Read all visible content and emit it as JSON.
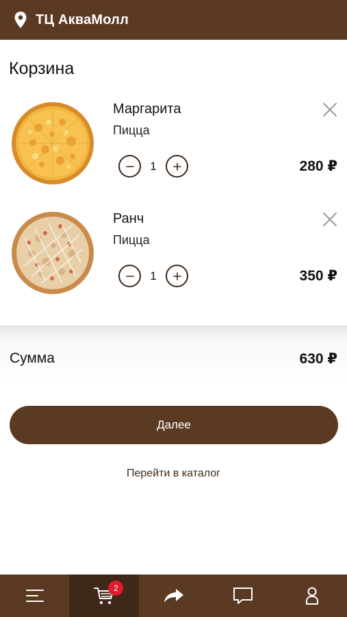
{
  "header": {
    "location": "ТЦ АкваМолл",
    "icon": "location-pin-icon"
  },
  "page": {
    "title": "Корзина"
  },
  "cart": {
    "items": [
      {
        "name": "Маргарита",
        "category": "Пицца",
        "quantity": "1",
        "price": "280 ₽"
      },
      {
        "name": "Ранч",
        "category": "Пицца",
        "quantity": "1",
        "price": "350 ₽"
      }
    ]
  },
  "summary": {
    "label": "Сумма",
    "total": "630 ₽"
  },
  "actions": {
    "next_label": "Далее",
    "catalog_link": "Перейти в каталог"
  },
  "tabbar": {
    "cart_badge": "2",
    "active_tab": "cart"
  },
  "colors": {
    "brand": "#5a3a22",
    "brand_dark": "#3f2818",
    "badge": "#e21b2e"
  }
}
